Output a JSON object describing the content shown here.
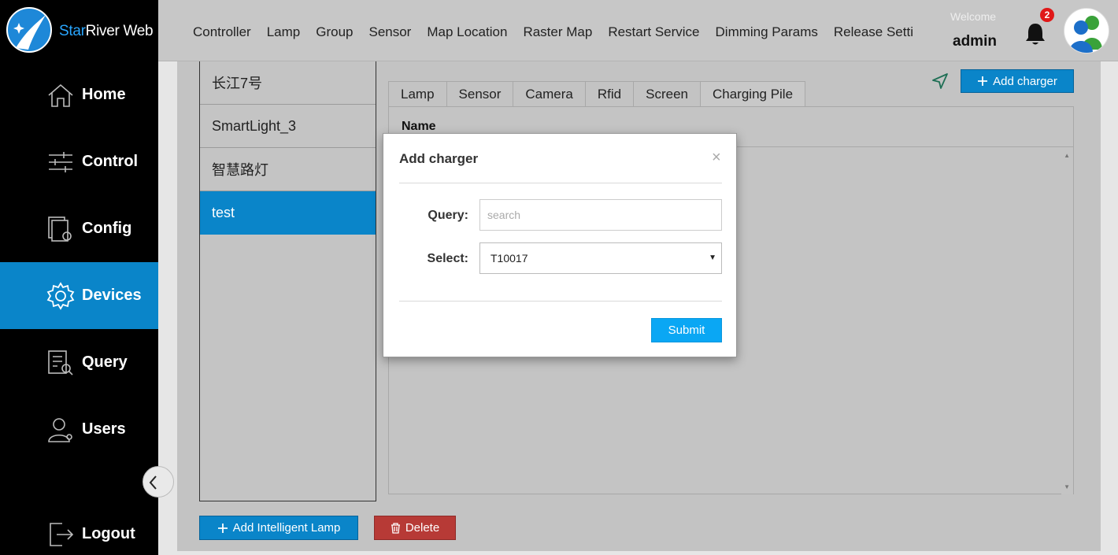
{
  "app": {
    "brand_prefix": "Star",
    "brand_suffix": "River Web"
  },
  "sidebar": {
    "items": [
      {
        "label": "Home",
        "icon": "home-icon"
      },
      {
        "label": "Control",
        "icon": "sliders-icon"
      },
      {
        "label": "Config",
        "icon": "config-icon"
      },
      {
        "label": "Devices",
        "icon": "gear-icon",
        "active": true
      },
      {
        "label": "Query",
        "icon": "query-icon"
      },
      {
        "label": "Users",
        "icon": "user-icon"
      }
    ],
    "logout": "Logout"
  },
  "topnav": [
    "Controller",
    "Lamp",
    "Group",
    "Sensor",
    "Map Location",
    "Raster Map",
    "Restart Service",
    "Dimming Params",
    "Release Setti"
  ],
  "user": {
    "welcome": "Welcome",
    "name": "admin",
    "notifications": "2"
  },
  "devices": [
    "长江7号",
    "SmartLight_3",
    "智慧路灯",
    "test"
  ],
  "tabs": [
    "Lamp",
    "Sensor",
    "Camera",
    "Rfid",
    "Screen",
    "Charging Pile"
  ],
  "toolbar": {
    "add_charger": "Add charger"
  },
  "table": {
    "column_name": "Name"
  },
  "actions": {
    "add_lamp": "Add Intelligent Lamp",
    "delete": "Delete"
  },
  "modal": {
    "title": "Add charger",
    "close": "×",
    "query_label": "Query:",
    "query_placeholder": "search",
    "select_label": "Select:",
    "select_value": "T10017",
    "submit": "Submit"
  },
  "colors": {
    "accent": "#0a85c9",
    "submit": "#0aa7f4",
    "danger": "#b73a36",
    "sidebar_bg": "#000000"
  }
}
